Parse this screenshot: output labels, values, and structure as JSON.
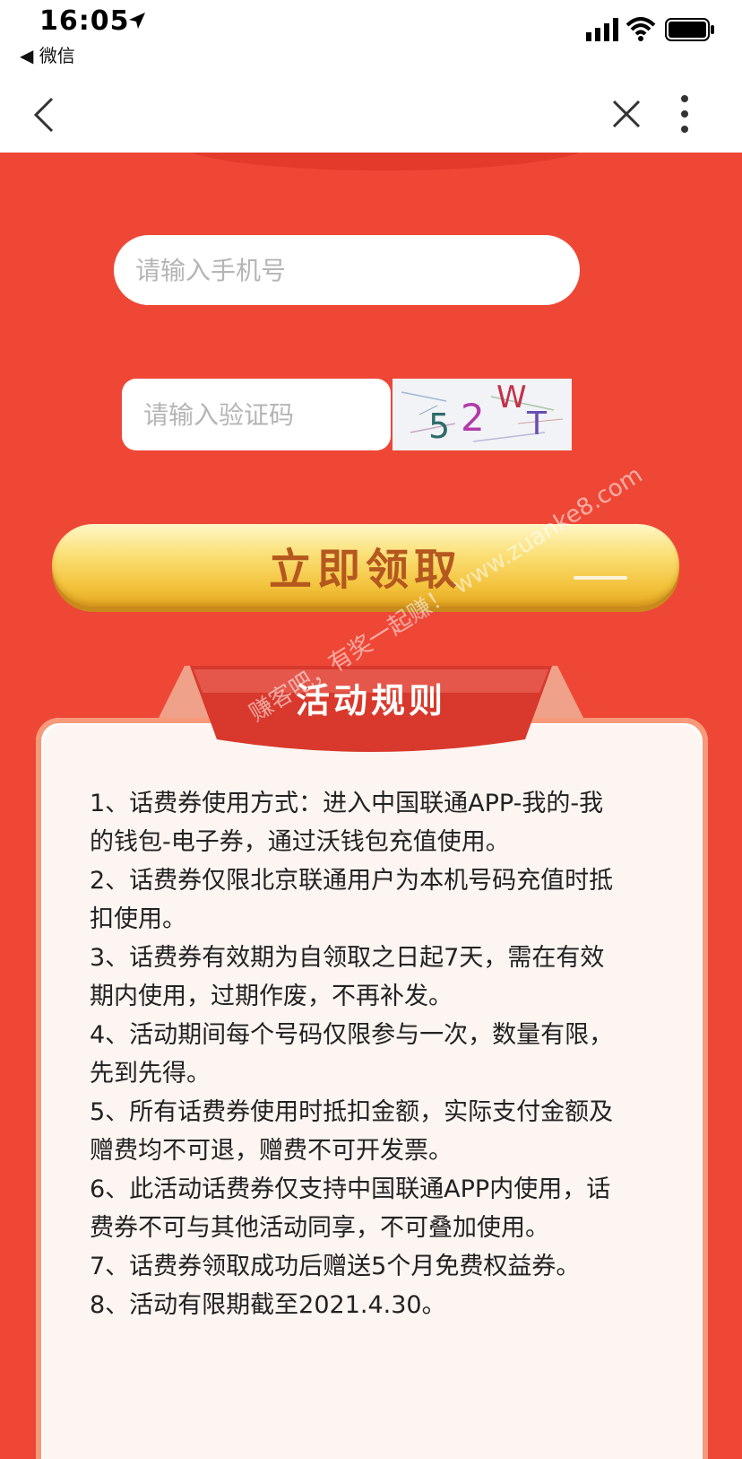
{
  "status_bar": {
    "time": "16:05",
    "back_app_label": "◀ 微信"
  },
  "nav": {
    "back_icon": "chevron-left-icon",
    "close_icon": "close-icon",
    "more_icon": "more-vertical-icon"
  },
  "form": {
    "phone_placeholder": "请输入手机号",
    "code_placeholder": "请输入验证码",
    "captcha_text": "52WT",
    "claim_label": "立即领取"
  },
  "rules": {
    "title": "活动规则",
    "items": [
      "1、话费券使用方式：进入中国联通APP-我的-我的钱包-电子券，通过沃钱包充值使用。",
      "2、话费券仅限北京联通用户为本机号码充值时抵扣使用。",
      "3、话费券有效期为自领取之日起7天，需在有效期内使用，过期作废，不再补发。",
      "4、活动期间每个号码仅限参与一次，数量有限，先到先得。",
      "5、所有话费券使用时抵扣金额，实际支付金额及赠费均不可退，赠费不可开发票。",
      "6、此活动话费券仅支持中国联通APP内使用，话费券不可与其他活动同享，不可叠加使用。",
      "7、话费券领取成功后赠送5个月免费权益券。",
      "8、活动有限期截至2021.4.30。"
    ]
  },
  "watermark": "赚客吧，有奖一起赚！ www.zuanke8.com",
  "colors": {
    "page_bg": "#ef4736",
    "button_text": "#b5581f",
    "banner": "#d8392c"
  }
}
